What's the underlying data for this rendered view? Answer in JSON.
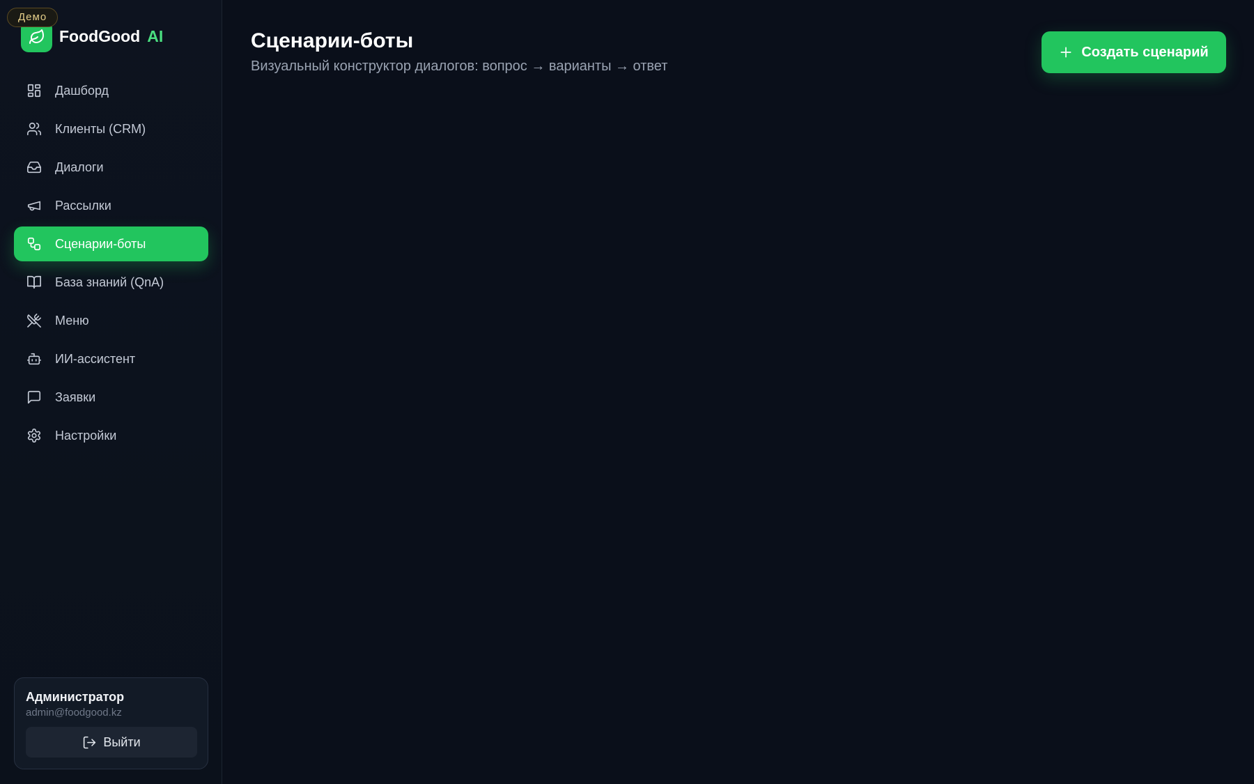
{
  "brand": {
    "badge": "Демо",
    "name": "FoodGood",
    "accent": "AI",
    "accent_color": "#4ade80",
    "logo_icon": "leaf-icon"
  },
  "sidebar": {
    "items": [
      {
        "label": "Дашборд",
        "icon": "dashboard-icon",
        "active": false
      },
      {
        "label": "Клиенты (CRM)",
        "icon": "users-icon",
        "active": false
      },
      {
        "label": "Диалоги",
        "icon": "inbox-icon",
        "active": false
      },
      {
        "label": "Рассылки",
        "icon": "megaphone-icon",
        "active": false
      },
      {
        "label": "Сценарии-боты",
        "icon": "workflow-icon",
        "active": true
      },
      {
        "label": "База знаний (QnA)",
        "icon": "book-icon",
        "active": false
      },
      {
        "label": "Меню",
        "icon": "utensils-icon",
        "active": false
      },
      {
        "label": "ИИ-ассистент",
        "icon": "bot-icon",
        "active": false
      },
      {
        "label": "Заявки",
        "icon": "message-icon",
        "active": false
      },
      {
        "label": "Настройки",
        "icon": "gear-icon",
        "active": false
      }
    ]
  },
  "user": {
    "name": "Администратор",
    "email": "admin@foodgood.kz",
    "logout_label": "Выйти"
  },
  "main": {
    "title": "Сценарии-боты",
    "subtitle": "Визуальный конструктор диалогов: вопрос → варианты → ответ",
    "create_label": "Создать сценарий"
  },
  "colors": {
    "accent": "#22c55e",
    "background": "#0a0f1a",
    "sidebar": "#0d131f"
  }
}
